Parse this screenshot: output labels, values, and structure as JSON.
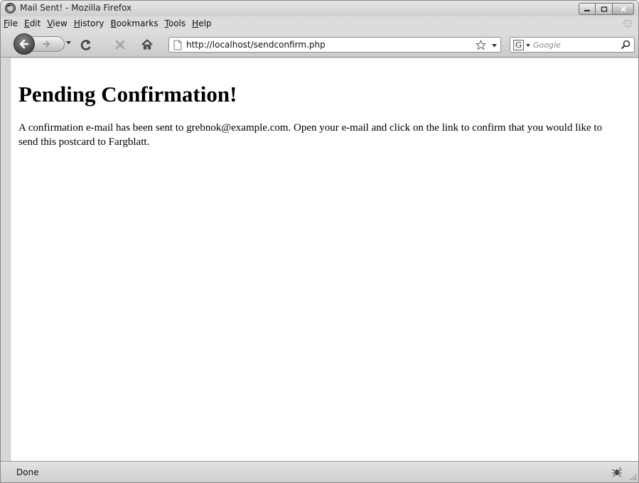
{
  "window": {
    "title": "Mail Sent! - Mozilla Firefox"
  },
  "menubar": {
    "items": [
      "File",
      "Edit",
      "View",
      "History",
      "Bookmarks",
      "Tools",
      "Help"
    ]
  },
  "navbar": {
    "url": "http://localhost/sendconfirm.php",
    "search_placeholder": "Google",
    "search_engine_letter": "G"
  },
  "page": {
    "heading": "Pending Confirmation!",
    "message": "A confirmation e-mail has been sent to grebnok@example.com. Open your e-mail and click on the link to confirm that you would like to send this postcard to Fargblatt."
  },
  "statusbar": {
    "text": "Done"
  },
  "icons": {
    "app": "firefox-icon",
    "back": "back-arrow-icon",
    "forward": "forward-arrow-icon",
    "reload": "reload-icon",
    "stop": "stop-icon",
    "home": "home-icon",
    "page": "page-icon",
    "bookmark": "star-icon",
    "search": "magnifier-icon",
    "status": "bug-icon"
  }
}
